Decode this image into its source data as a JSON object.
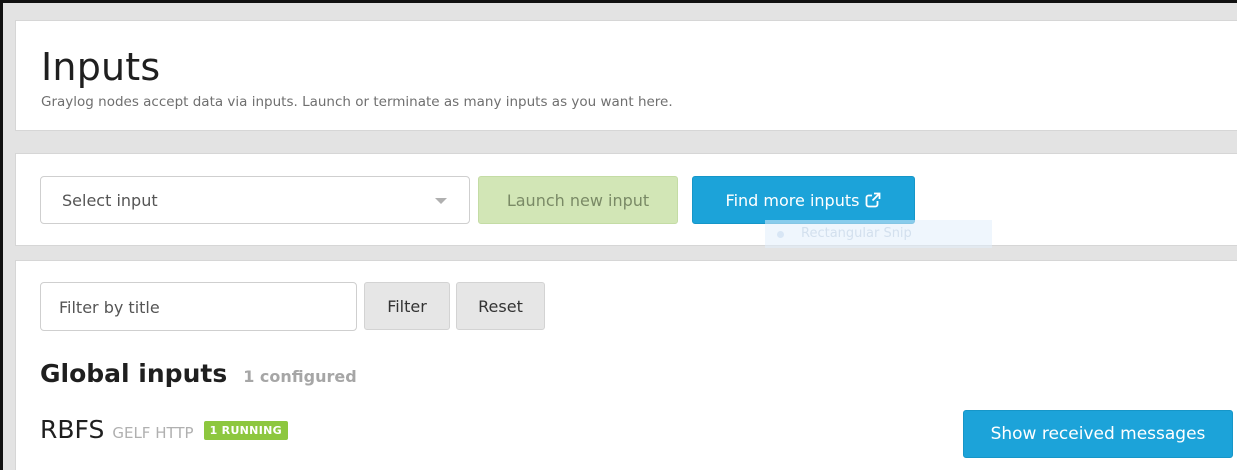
{
  "header": {
    "title": "Inputs",
    "subtitle": "Graylog nodes accept data via inputs. Launch or terminate as many inputs as you want here."
  },
  "launch": {
    "select_placeholder": "Select input",
    "launch_label": "Launch new input",
    "find_more_label": "Find more inputs",
    "find_more_icon": "external-link-icon"
  },
  "overlay": {
    "snip_label": "Rectangular Snip"
  },
  "filter": {
    "placeholder": "Filter by title",
    "filter_label": "Filter",
    "reset_label": "Reset"
  },
  "global_inputs": {
    "heading": "Global inputs",
    "count_label": "1 configured",
    "items": [
      {
        "name": "RBFS",
        "type": "GELF HTTP",
        "status": "1 RUNNING",
        "action_label": "Show received messages"
      }
    ]
  },
  "colors": {
    "primary": "#1ca3d9",
    "success": "#8dc73f",
    "launch_disabled": "#d2e6b6"
  }
}
